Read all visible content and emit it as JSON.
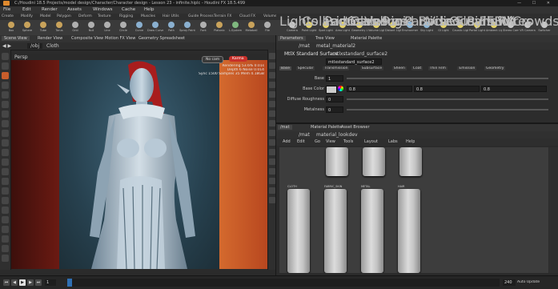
{
  "window": {
    "title": "C:/Houdini 18.5 Projects/model design/Character/Character design - Lesson 23 - infinite.hiplc - Houdini FX 18.5.499"
  },
  "menu": [
    "File",
    "Edit",
    "Render",
    "Assets",
    "Windows",
    "Cache",
    "Help"
  ],
  "shelf_tabs": [
    "Create",
    "Modify",
    "Model",
    "Polygon",
    "Deform",
    "Texture",
    "Rigging",
    "Muscles",
    "Hair Utils",
    "Guide Process",
    "Terrain FX",
    "Cloud FX",
    "Volume",
    "Lights and Cameras",
    "Collisions",
    "Particles",
    "Grains",
    "Vellum",
    "Rigid Bodies",
    "Particle Fluids",
    "Viscous Fluids",
    "Oceans",
    "Pyro FX",
    "FEM",
    "Wires",
    "Crowds",
    "Drive Simulation"
  ],
  "shelf_tools": [
    {
      "label": "Box",
      "color": "#c9a35b"
    },
    {
      "label": "Sphere",
      "color": "#c9a35b"
    },
    {
      "label": "Tube",
      "color": "#c9a35b"
    },
    {
      "label": "Torus",
      "color": "#c9a35b"
    },
    {
      "label": "Grid",
      "color": "#b0b0b0"
    },
    {
      "label": "Null",
      "color": "#b0b0b0"
    },
    {
      "label": "Line",
      "color": "#b0b0b0"
    },
    {
      "label": "Circle",
      "color": "#b0b0b0"
    },
    {
      "label": "Curve",
      "color": "#8ab0d0"
    },
    {
      "label": "Draw Curve",
      "color": "#8ab0d0"
    },
    {
      "label": "Path",
      "color": "#8ab0d0"
    },
    {
      "label": "Spray Paint",
      "color": "#8ab0d0"
    },
    {
      "label": "Font",
      "color": "#b0b0b0"
    },
    {
      "label": "Platonic",
      "color": "#c9a35b"
    },
    {
      "label": "L-System",
      "color": "#7fb87f"
    },
    {
      "label": "Metaball",
      "color": "#c9a35b"
    },
    {
      "label": "File",
      "color": "#b0b0b0"
    }
  ],
  "right_shelf_tabs": [
    "Lights and Cameras",
    "Collisions",
    "Particles",
    "Grains",
    "Vellum",
    "Rigid Bodies",
    "Particle Fluids",
    "Viscous Fluids",
    "Oceans",
    "Pyro FX",
    "FEM",
    "Wires",
    "Crowds"
  ],
  "right_tools": [
    {
      "label": "Camera",
      "color": "#c7c7c7"
    },
    {
      "label": "Point Light",
      "color": "#e2d16a"
    },
    {
      "label": "Spot Light",
      "color": "#e2d16a"
    },
    {
      "label": "Area Light",
      "color": "#e2d16a"
    },
    {
      "label": "Geometry Light",
      "color": "#e2d16a"
    },
    {
      "label": "Volume Light",
      "color": "#e2d16a"
    },
    {
      "label": "Distant Light",
      "color": "#e2d16a"
    },
    {
      "label": "Environment Light",
      "color": "#8fb7d6"
    },
    {
      "label": "Sky Light",
      "color": "#8fb7d6"
    },
    {
      "label": "GI Light",
      "color": "#e2d16a"
    },
    {
      "label": "Caustic Light",
      "color": "#e2d16a"
    },
    {
      "label": "Portal Light",
      "color": "#e2d16a"
    },
    {
      "label": "Ambient Light",
      "color": "#e2d16a"
    },
    {
      "label": "Stereo Camera",
      "color": "#c7c7c7"
    },
    {
      "label": "VR Camera",
      "color": "#c7c7c7"
    },
    {
      "label": "Switcher",
      "color": "#c7c7c7"
    }
  ],
  "left_pane": {
    "tabs": [
      "Scene View",
      "Render View",
      "Composite View",
      "Motion FX View",
      "Geometry Spreadsheet"
    ],
    "path": "/obj",
    "node": "Cloth",
    "view_label": "Persp",
    "badge_camera": "No cam",
    "badge_render": "Karma",
    "stats": [
      "Rendering  53.6%  0.01s",
      "Depth  6  Noise  0.014",
      "Sync 1500  Samples 35  Mem 4.18GB"
    ]
  },
  "parm_pane": {
    "tabs": [
      "Parameters",
      "Tree View",
      "Material Palette"
    ],
    "path": "/mat",
    "node": "metal_material2",
    "node_type": "MtlX Standard Surface",
    "node_name": "mtlxstandard_surface2",
    "subtabs": [
      "Base",
      "Specular",
      "Transmission",
      "Subsurface",
      "Sheen",
      "Coat",
      "Thin Film",
      "Emission",
      "Geometry"
    ],
    "parms": [
      {
        "label": "Base",
        "value": "1"
      },
      {
        "label": "Base Color",
        "value": "0.8",
        "value2": "0.8",
        "value3": "0.8"
      },
      {
        "label": "Diffuse Roughness",
        "value": "0"
      },
      {
        "label": "Metalness",
        "value": "0"
      }
    ]
  },
  "net_pane": {
    "tabs": [
      "/mat",
      "Material Palette",
      "Asset Browser"
    ],
    "path": "/mat",
    "node": "material_lookdev",
    "menu": [
      "Add",
      "Edit",
      "Go",
      "View",
      "Tools",
      "Layout",
      "Labs",
      "Help"
    ],
    "nodes_row2": [
      "CLOTH",
      "FABRIC_SKIN",
      "METAL",
      "HAIR"
    ]
  },
  "timeline": {
    "frame": "1",
    "end_frame": "240",
    "status": "Auto Update"
  },
  "colors": {
    "accent": "#e08a2e",
    "highlight": "#c85d2b",
    "bg": "#2b2b2b"
  }
}
